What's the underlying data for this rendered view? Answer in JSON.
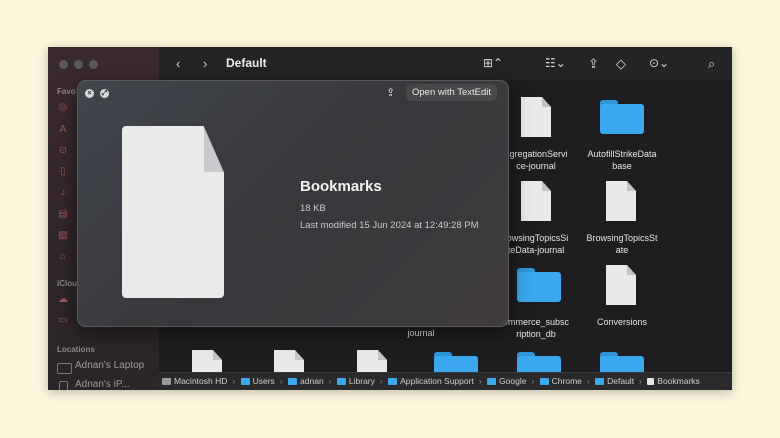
{
  "toolbar": {
    "title": "Default",
    "back_icon": "chevron-left-icon",
    "forward_icon": "chevron-right-icon",
    "view_icon": "grid-view-icon",
    "group_icon": "group-by-icon",
    "share_icon": "share-icon",
    "tag_icon": "tag-icon",
    "more_icon": "more-icon",
    "search_icon": "search-icon"
  },
  "sidebar": {
    "favorites_label": "Favo",
    "icloud_label": "iClou",
    "locations_label": "Locations",
    "locations": [
      {
        "label": "Adnan's Laptop"
      },
      {
        "label": "Adnan's iP..."
      }
    ]
  },
  "files": [
    {
      "name": "ggregationServi\nce-journal",
      "kind": "doc"
    },
    {
      "name": "AutofillStrikeData\nbase",
      "kind": "folder"
    },
    {
      "name": "rowsingTopicsSi\nteData-journal",
      "kind": "doc"
    },
    {
      "name": "BrowsingTopicsSt\nate",
      "kind": "doc"
    },
    {
      "name": "journal",
      "kind": "text"
    },
    {
      "name": "ommerce_subsc\nription_db",
      "kind": "folder"
    },
    {
      "name": "Conversions",
      "kind": "doc"
    }
  ],
  "quicklook": {
    "title": "Bookmarks",
    "size": "18 KB",
    "modified": "Last modified 15 Jun 2024 at 12:49:28 PM",
    "open_button": "Open with TextEdit"
  },
  "pathbar": {
    "segments": [
      "Macintosh HD",
      "Users",
      "adnan",
      "Library",
      "Application Support",
      "Google",
      "Chrome",
      "Default",
      "Bookmarks"
    ]
  },
  "colors": {
    "accent": "#3aa8ee",
    "background": "#fbf6dc"
  }
}
